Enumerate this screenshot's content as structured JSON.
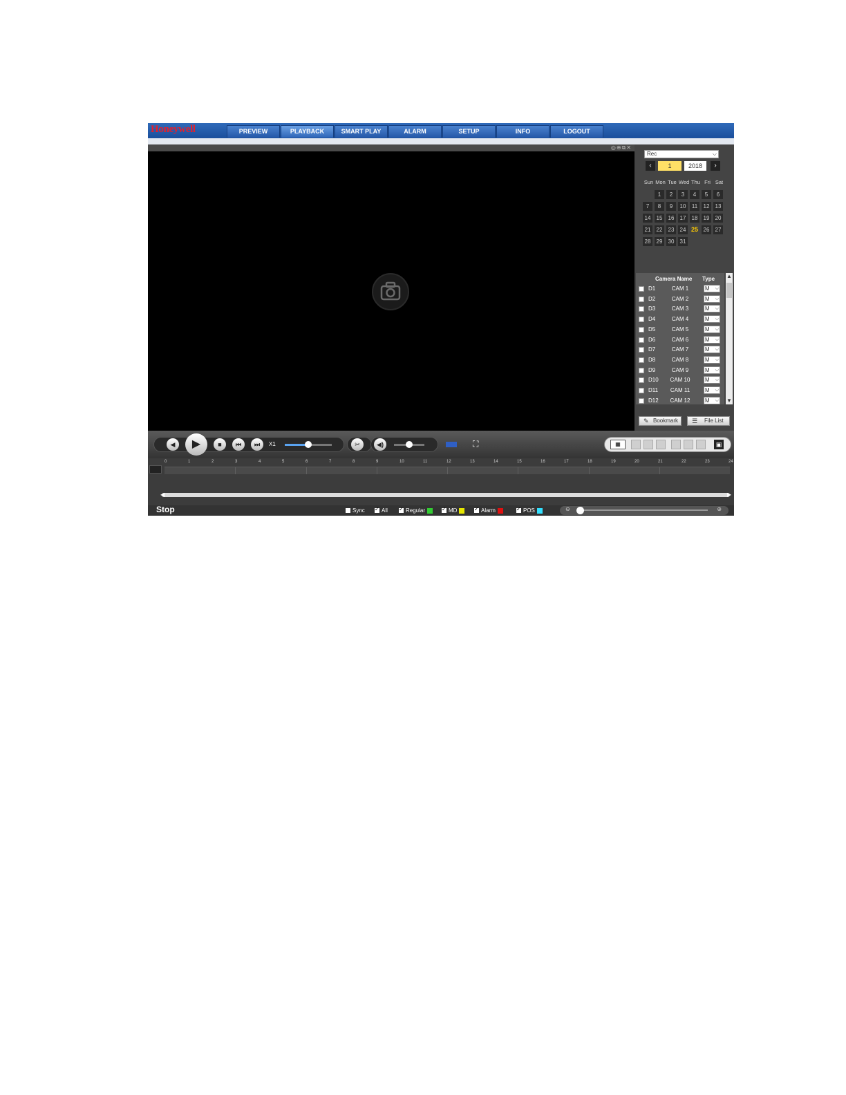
{
  "header": {
    "logo": "Honeywell",
    "tabs": [
      "PREVIEW",
      "PLAYBACK",
      "SMART PLAY",
      "ALARM",
      "SETUP",
      "INFO",
      "LOGOUT"
    ],
    "active_tab": "PLAYBACK"
  },
  "video": {
    "window_icons": "◎⊕⧉✕"
  },
  "calendar": {
    "record_type": "Rec",
    "month": "1",
    "year": "2018",
    "weekdays": [
      "Sun",
      "Mon",
      "Tue",
      "Wed",
      "Thu",
      "Fri",
      "Sat"
    ],
    "first_weekday_index": 1,
    "days_in_month": 31,
    "highlight_day": "25"
  },
  "camera_list": {
    "header_name": "Camera Name",
    "header_type": "Type",
    "rows": [
      {
        "id": "D1",
        "name": "CAM 1",
        "type": "M"
      },
      {
        "id": "D2",
        "name": "CAM 2",
        "type": "M"
      },
      {
        "id": "D3",
        "name": "CAM 3",
        "type": "M"
      },
      {
        "id": "D4",
        "name": "CAM 4",
        "type": "M"
      },
      {
        "id": "D5",
        "name": "CAM 5",
        "type": "M"
      },
      {
        "id": "D6",
        "name": "CAM 6",
        "type": "M"
      },
      {
        "id": "D7",
        "name": "CAM 7",
        "type": "M"
      },
      {
        "id": "D8",
        "name": "CAM 8",
        "type": "M"
      },
      {
        "id": "D9",
        "name": "CAM 9",
        "type": "M"
      },
      {
        "id": "D10",
        "name": "CAM 10",
        "type": "M"
      },
      {
        "id": "D11",
        "name": "CAM 11",
        "type": "M"
      },
      {
        "id": "D12",
        "name": "CAM 12",
        "type": "M"
      }
    ]
  },
  "panel_buttons": {
    "bookmark": "Bookmark",
    "file_list": "File List"
  },
  "controls": {
    "speed": "X1",
    "speed_level": 0.5,
    "volume_level": 0.5
  },
  "timeline": {
    "hours": [
      "0",
      "1",
      "2",
      "3",
      "4",
      "5",
      "6",
      "7",
      "8",
      "9",
      "10",
      "11",
      "12",
      "13",
      "14",
      "15",
      "16",
      "17",
      "18",
      "19",
      "20",
      "21",
      "22",
      "23",
      "24"
    ]
  },
  "status": {
    "text": "Stop",
    "legend": [
      {
        "label": "Sync",
        "checked": false,
        "color": ""
      },
      {
        "label": "All",
        "checked": true,
        "color": ""
      },
      {
        "label": "Regular",
        "checked": true,
        "color": "#33cc33"
      },
      {
        "label": "MD",
        "checked": true,
        "color": "#e6e600"
      },
      {
        "label": "Alarm",
        "checked": true,
        "color": "#e01010"
      },
      {
        "label": "POS",
        "checked": true,
        "color": "#33e0ff"
      }
    ]
  },
  "colors": {
    "header_blue": "#1b4f9c",
    "logo_red": "#e3202c",
    "highlight_day": "#ffcc00",
    "month_box": "#ffe066"
  }
}
